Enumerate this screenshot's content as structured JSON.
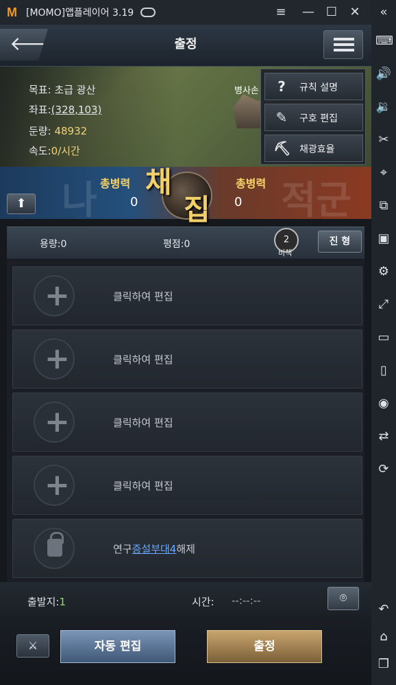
{
  "window": {
    "title": "[MOMO]앱플레이어 3.19",
    "logo": "M",
    "controls": {
      "menu": "≡",
      "minimize": "—",
      "maximize": "☐",
      "close": "✕",
      "collapse": "«"
    }
  },
  "header": {
    "title": "출정",
    "back_icon": "arrow-left-icon",
    "menu_icon": "list-icon"
  },
  "target_info": {
    "target_label": "목표:",
    "target_value": "초급 광산",
    "coord_label": "좌표:",
    "coord_value": "(328,103)",
    "troops_label": "둔량:",
    "troops_value": "48932",
    "speed_label": "속도:",
    "speed_value": "0/시간",
    "overlay_label": "병사손"
  },
  "popup_menu": {
    "items": [
      {
        "label": "규칙 설명",
        "icon": "question-icon"
      },
      {
        "label": "구호 편집",
        "icon": "brush-icon"
      },
      {
        "label": "채광효율",
        "icon": "pickaxe-icon"
      }
    ]
  },
  "battle": {
    "left_label": "총병력",
    "left_value": "0",
    "right_label": "총병력",
    "right_value": "0",
    "emblem_char1": "채",
    "emblem_char2": "집",
    "bg_left": "나",
    "bg_right": "적군"
  },
  "capacity": {
    "capacity_label": "용량:0",
    "rating_label": "평점:0",
    "book_count": "2",
    "book_label": "비책",
    "formation_button": "진 형"
  },
  "slots": [
    {
      "text": "클릭하여 편집",
      "type": "add"
    },
    {
      "text": "클릭하여 편집",
      "type": "add"
    },
    {
      "text": "클릭하여 편집",
      "type": "add"
    },
    {
      "text": "클릭하여 편집",
      "type": "add"
    }
  ],
  "locked_slot": {
    "prefix": "연구",
    "link": "증설부대4",
    "suffix": "해제"
  },
  "footer": {
    "depart_label": "출발지:",
    "depart_value": "1",
    "time_label": "시간:",
    "time_value": "--:--:--"
  },
  "buttons": {
    "auto_edit": "자동 편집",
    "march": "출정"
  },
  "colors": {
    "accent_gold": "#f2d16a",
    "link_blue": "#6aa8ff",
    "depart_green": "#8fe06a",
    "logo_orange": "#f39a1d"
  }
}
